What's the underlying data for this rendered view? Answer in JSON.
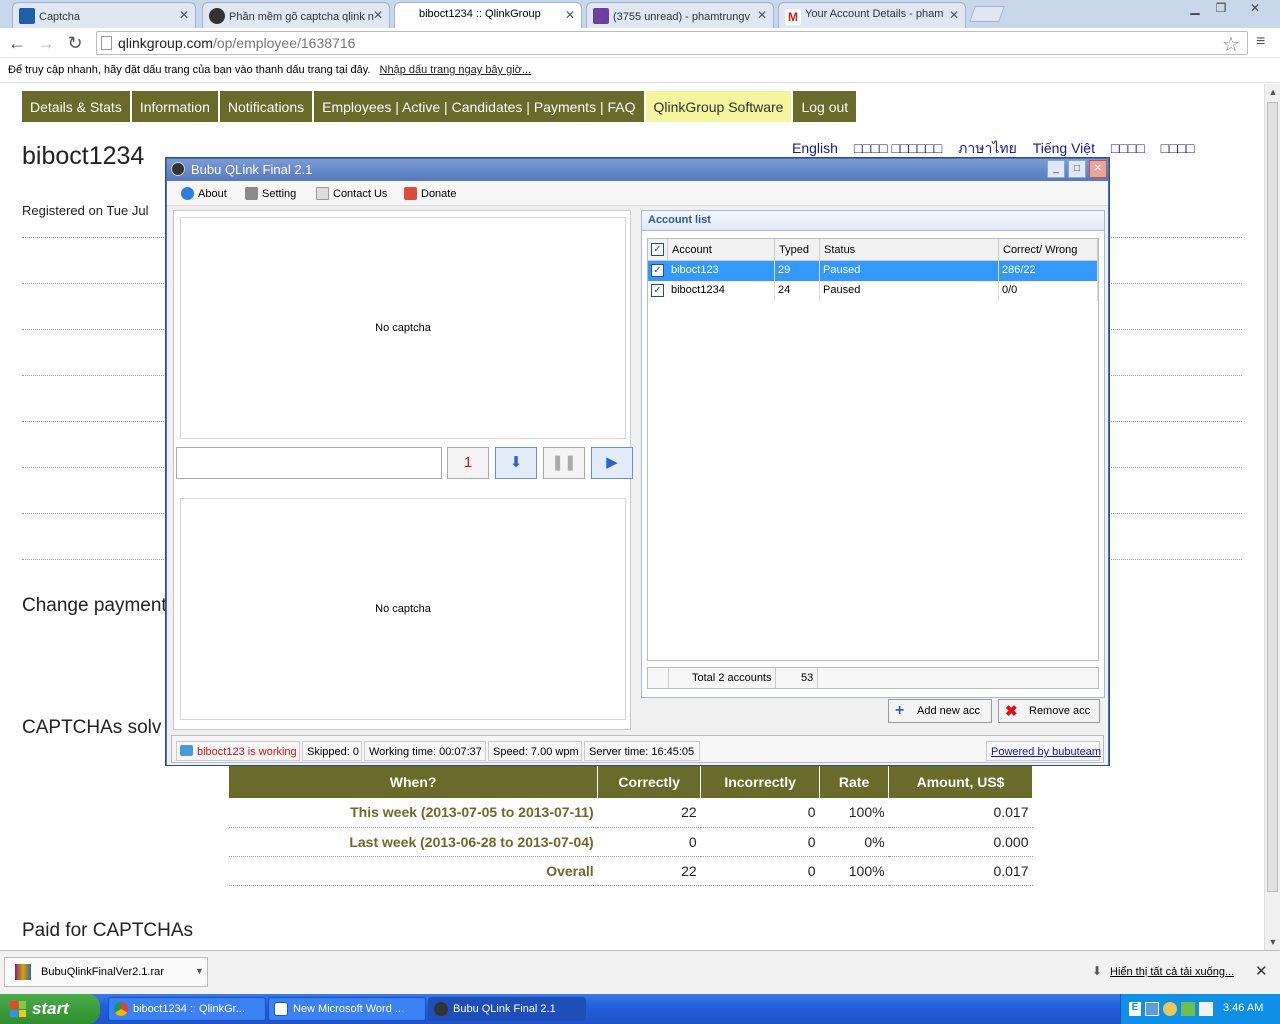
{
  "browser": {
    "tabs": [
      {
        "title": "Captcha",
        "icon": "qlink-icon",
        "color": "#1f5fa8"
      },
      {
        "title": "Phần mềm gõ captcha qlink n",
        "icon": "bubu-icon",
        "color": "#333333"
      },
      {
        "title": "biboct1234 :: QlinkGroup",
        "icon": "",
        "color": ""
      },
      {
        "title": "(3755 unread) - phamtrungv",
        "icon": "mail-icon",
        "color": "#6b3fa0"
      },
      {
        "title": "Your Account Details - pham",
        "icon": "gmail-icon",
        "color": "#c5221f"
      }
    ],
    "url_domain": "qlinkgroup.com",
    "url_path": "/op/employee/1638716",
    "bookmark_prompt": "Để truy cập nhanh, hãy đặt dấu trang của bạn vào thanh dấu trang tại đây.",
    "bookmark_link": "Nhập dấu trang ngay bây giờ..."
  },
  "site": {
    "nav": [
      "Details & Stats",
      "Information",
      "Notifications",
      "Employees | Active | Candidates | Payments | FAQ",
      "QlinkGroup Software",
      "Log out"
    ],
    "username": "biboct1234",
    "languages": [
      "English",
      "□□□□ □□□□□□",
      "ภาษาไทย",
      "Tiếng Việt",
      "□□□□",
      "□□□□"
    ],
    "registered": "Registered on Tue Jul",
    "change_payment": "Change payment",
    "captchas_solved": "CAPTCHAs solv",
    "paid_heading": "Paid for CAPTCHAs",
    "stats": {
      "headers": [
        "When?",
        "Correctly",
        "Incorrectly",
        "Rate",
        "Amount, US$"
      ],
      "rows": [
        {
          "when": "This week (2013-07-05 to 2013-07-11)",
          "correct": "22",
          "incorrect": "0",
          "rate": "100%",
          "amount": "0.017"
        },
        {
          "when": "Last week (2013-06-28 to 2013-07-04)",
          "correct": "0",
          "incorrect": "0",
          "rate": "0%",
          "amount": "0.000"
        },
        {
          "when": "Overall",
          "correct": "22",
          "incorrect": "0",
          "rate": "100%",
          "amount": "0.017"
        }
      ]
    }
  },
  "app": {
    "title": "Bubu QLink Final 2.1",
    "menu": {
      "about": "About",
      "setting": "Setting",
      "contact": "Contact Us",
      "donate": "Donate"
    },
    "no_captcha_top": "No captcha",
    "no_captcha_bottom": "No captcha",
    "counter": "1",
    "account_list": {
      "title": "Account list",
      "headers": [
        "Account",
        "Typed",
        "Status",
        "Correct/ Wrong"
      ],
      "rows": [
        {
          "account": "biboct123",
          "typed": "29",
          "status": "Paused",
          "cw": "286/22",
          "checked": true,
          "selected": true
        },
        {
          "account": "biboct1234",
          "typed": "24",
          "status": "Paused",
          "cw": "0/0",
          "checked": true,
          "selected": false
        }
      ],
      "total_label": "Total 2 accounts",
      "total_value": "53",
      "add_button": "Add new acc",
      "remove_button": "Remove acc"
    },
    "status": {
      "working": "biboct123 is working",
      "skipped": "Skipped: 0",
      "working_time": "Working time: 00:07:37",
      "speed": "Speed: 7.00 wpm",
      "server_time": "Server time: 16:45:05",
      "powered": "Powered by bubuteam"
    }
  },
  "downloads": {
    "file": "BubuQlinkFinalVer2.1.rar",
    "show_all": "Hiển thị tất cả tải xuống..."
  },
  "taskbar": {
    "start": "start",
    "items": [
      "biboct1234 :: QlinkGr...",
      "New Microsoft Word ...",
      "Bubu QLink Final 2.1"
    ],
    "clock": "3:46 AM"
  }
}
